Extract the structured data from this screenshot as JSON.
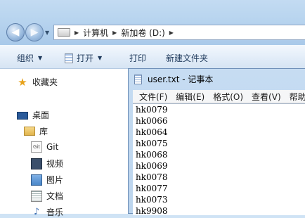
{
  "address": {
    "crumbs": [
      "计算机",
      "新加卷 (D:)"
    ]
  },
  "toolbar": {
    "organize": "组织",
    "open": "打开",
    "print": "打印",
    "new_folder": "新建文件夹"
  },
  "nav": {
    "favorites": "收藏夹",
    "desktop": "桌面",
    "library": "库",
    "git": "Git",
    "videos": "视频",
    "pictures": "图片",
    "documents": "文档",
    "music": "音乐"
  },
  "notepad": {
    "title": "user.txt - 记事本",
    "menu": [
      "文件(F)",
      "编辑(E)",
      "格式(O)",
      "查看(V)",
      "帮助"
    ],
    "lines": [
      "hk0079",
      "hk0066",
      "hk0064",
      "hk0075",
      "hk0068",
      "hk0069",
      "hk0078",
      "hk0077",
      "hk0073",
      "hk9908"
    ]
  }
}
